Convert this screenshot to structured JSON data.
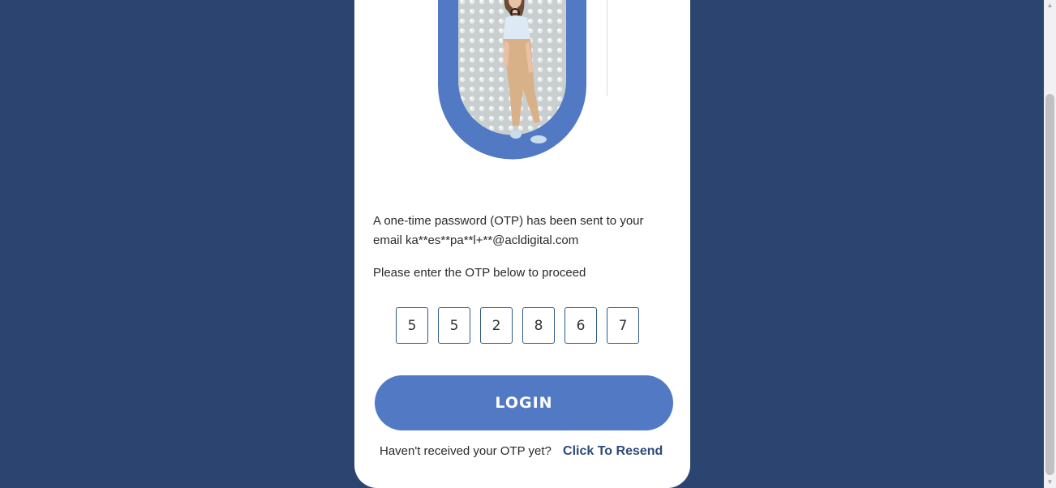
{
  "otp_message": "A one-time password (OTP) has been sent to your email ka**es**pa**l+**@acldigital.com",
  "otp_prompt": "Please enter the OTP below to proceed",
  "otp_digits": [
    "5",
    "5",
    "2",
    "8",
    "6",
    "7"
  ],
  "login_label": "LOGIN",
  "resend_text": "Haven't received your OTP yet?",
  "resend_link": "Click To Resend",
  "scroll": {
    "up_arrow": "▲",
    "down_arrow": "▼"
  },
  "colors": {
    "background": "#2b4570",
    "card": "#ffffff",
    "accent": "#5179c4",
    "link": "#2b4a7a",
    "otp_border": "#2f5a88"
  }
}
